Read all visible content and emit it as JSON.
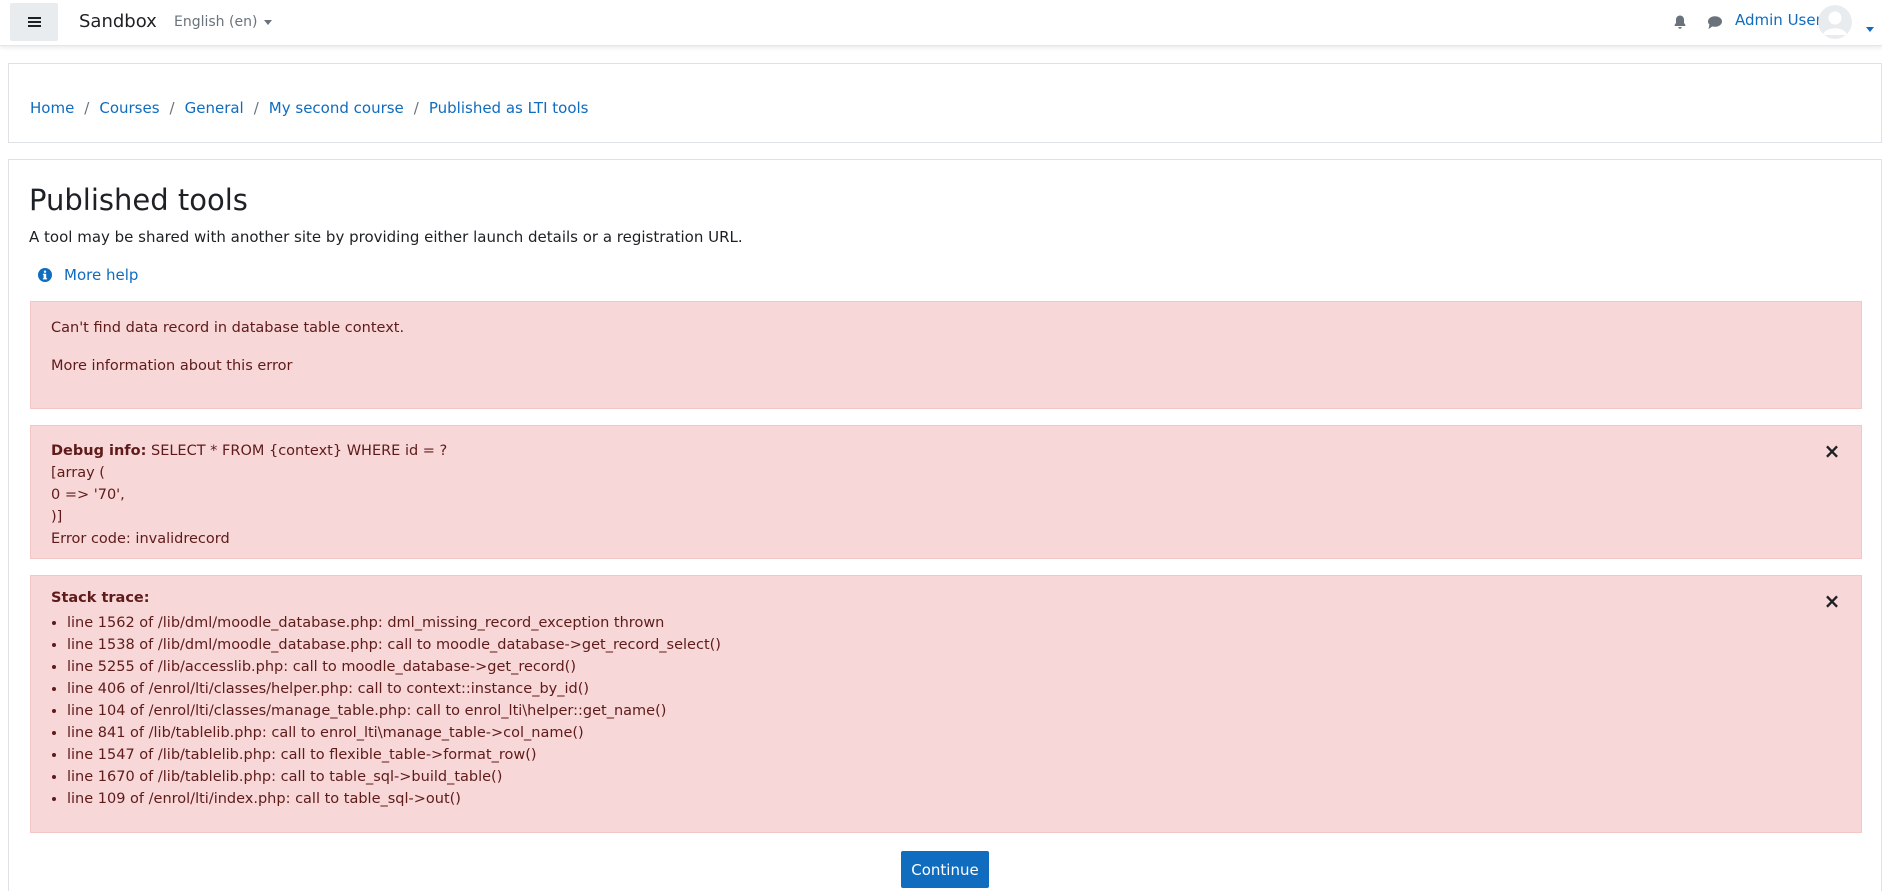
{
  "navbar": {
    "site_name": "Sandbox",
    "language": "English (en)",
    "user_name": "Admin User",
    "icons": [
      "hamburger-icon",
      "bell-icon",
      "chat-icon",
      "avatar-icon",
      "chevron-down-icon"
    ]
  },
  "breadcrumb": {
    "items": [
      "Home",
      "Courses",
      "General",
      "My second course",
      "Published as LTI tools"
    ],
    "separator": "/"
  },
  "main": {
    "title": "Published tools",
    "description": "A tool may be shared with another site by providing either launch details or a registration URL.",
    "more_help": "More help",
    "error_message": "Can't find data record in database table context.",
    "error_more_info": "More information about this error",
    "debug": {
      "label": "Debug info:",
      "query": " SELECT * FROM {context} WHERE id = ?",
      "lines": [
        "[array (",
        "0 => '70',",
        ")]",
        "Error code: invalidrecord"
      ]
    },
    "stack": {
      "title": "Stack trace:",
      "lines": [
        "line 1562 of /lib/dml/moodle_database.php: dml_missing_record_exception thrown",
        "line 1538 of /lib/dml/moodle_database.php: call to moodle_database->get_record_select()",
        "line 5255 of /lib/accesslib.php: call to moodle_database->get_record()",
        "line 406 of /enrol/lti/classes/helper.php: call to context::instance_by_id()",
        "line 104 of /enrol/lti/classes/manage_table.php: call to enrol_lti\\helper::get_name()",
        "line 841 of /lib/tablelib.php: call to enrol_lti\\manage_table->col_name()",
        "line 1547 of /lib/tablelib.php: call to flexible_table->format_row()",
        "line 1670 of /lib/tablelib.php: call to table_sql->build_table()",
        "line 109 of /enrol/lti/index.php: call to table_sql->out()"
      ]
    },
    "close_symbol": "×",
    "continue_label": "Continue"
  },
  "colors": {
    "brand_blue": "#0f6cbf",
    "alert_bg": "#f7d7d7",
    "alert_text": "#5e1b1a"
  }
}
